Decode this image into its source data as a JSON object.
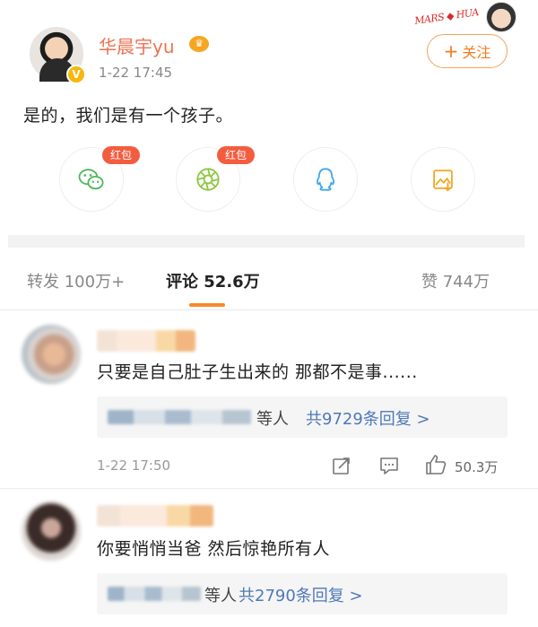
{
  "post": {
    "username": "华晨宇yu",
    "time": "1-22 17:45",
    "follow_label": "关注",
    "text": "是的，我们是有一个孩子。",
    "brand_text": "MARS ◆ HUA",
    "share": [
      {
        "icon": "wechat-icon",
        "badge": "红包"
      },
      {
        "icon": "moments-icon",
        "badge": "红包"
      },
      {
        "icon": "qq-icon",
        "badge": ""
      },
      {
        "icon": "save-image-icon",
        "badge": ""
      }
    ]
  },
  "tabs": {
    "repost": "转发 100万+",
    "comments": "评论 52.6万",
    "likes": "赞 744万"
  },
  "comments": [
    {
      "text": "只要是自己肚子生出来的 那都不是事......",
      "reply_suffix": "等人",
      "reply_link": "共9729条回复 >",
      "time": "1-22 17:50",
      "likes": "50.3万"
    },
    {
      "text": "你要悄悄当爸 然后惊艳所有人",
      "reply_suffix": "等人",
      "reply_link": "共2790条回复 >"
    }
  ],
  "colors": {
    "accent": "#f7892a",
    "username": "#eb7350",
    "link": "#4f79b8",
    "redpack": "#f35d3f"
  }
}
